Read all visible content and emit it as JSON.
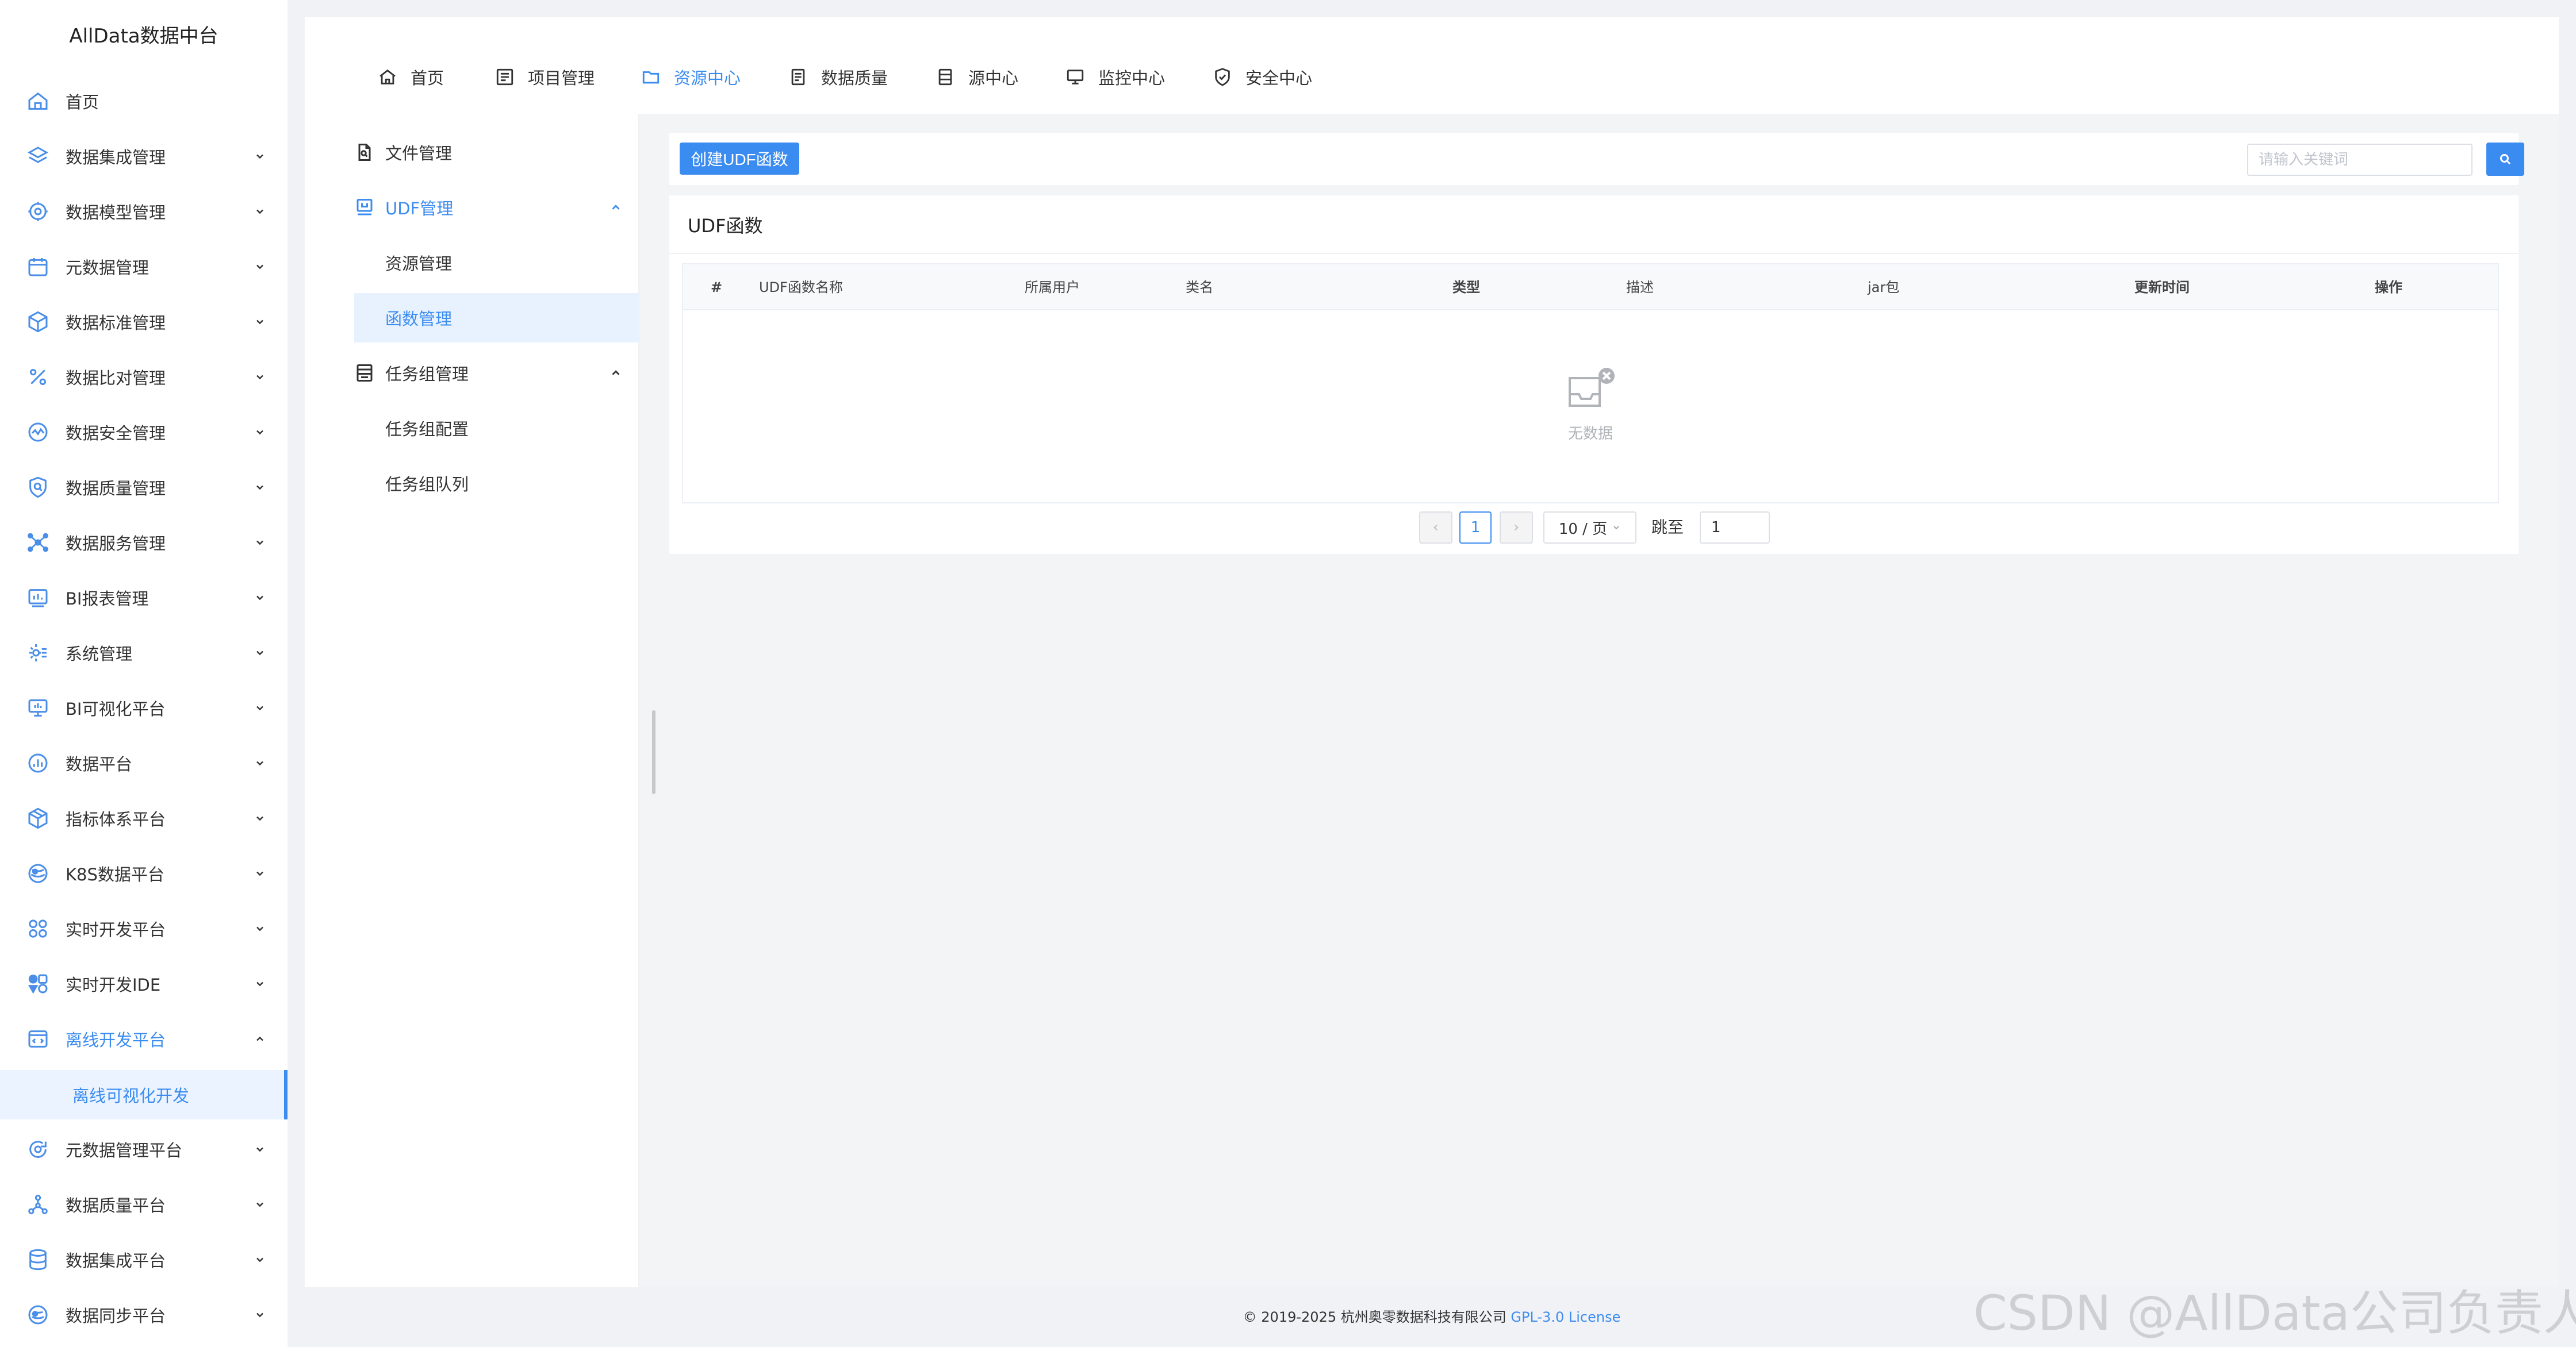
{
  "app": {
    "title": "AllData数据中台"
  },
  "sidebar": {
    "items": [
      {
        "label": "首页",
        "icon": "home-icon",
        "has_arrow": false
      },
      {
        "label": "数据集成管理",
        "icon": "layers-icon",
        "has_arrow": true
      },
      {
        "label": "数据模型管理",
        "icon": "cog-icon",
        "has_arrow": true
      },
      {
        "label": "元数据管理",
        "icon": "calendar-icon",
        "has_arrow": true
      },
      {
        "label": "数据标准管理",
        "icon": "cube-icon",
        "has_arrow": true
      },
      {
        "label": "数据比对管理",
        "icon": "percent-icon",
        "has_arrow": true
      },
      {
        "label": "数据安全管理",
        "icon": "shield-pulse-icon",
        "has_arrow": true
      },
      {
        "label": "数据质量管理",
        "icon": "search-shield-icon",
        "has_arrow": true
      },
      {
        "label": "数据服务管理",
        "icon": "network-icon",
        "has_arrow": true
      },
      {
        "label": "BI报表管理",
        "icon": "report-icon",
        "has_arrow": true
      },
      {
        "label": "系统管理",
        "icon": "gear-icon",
        "has_arrow": true
      },
      {
        "label": "BI可视化平台",
        "icon": "monitor-icon",
        "has_arrow": true
      },
      {
        "label": "数据平台",
        "icon": "chart-circle-icon",
        "has_arrow": true
      },
      {
        "label": "指标体系平台",
        "icon": "box-icon",
        "has_arrow": true
      },
      {
        "label": "K8S数据平台",
        "icon": "globe-icon",
        "has_arrow": true
      },
      {
        "label": "实时开发平台",
        "icon": "apps-icon",
        "has_arrow": true
      },
      {
        "label": "实时开发IDE",
        "icon": "ide-icon",
        "has_arrow": true
      },
      {
        "label": "离线开发平台",
        "icon": "code-window-icon",
        "has_arrow": true,
        "open": true
      },
      {
        "label": "元数据管理平台",
        "icon": "refresh-circle-icon",
        "has_arrow": true
      },
      {
        "label": "数据质量平台",
        "icon": "molecule-icon",
        "has_arrow": true
      },
      {
        "label": "数据集成平台",
        "icon": "database-icon",
        "has_arrow": true
      },
      {
        "label": "数据同步平台",
        "icon": "sync-globe-icon",
        "has_arrow": true
      }
    ],
    "open_sub": {
      "label": "离线可视化开发"
    }
  },
  "topnav": {
    "items": [
      {
        "label": "首页",
        "icon": "home-icon"
      },
      {
        "label": "项目管理",
        "icon": "project-icon"
      },
      {
        "label": "资源中心",
        "icon": "folder-icon",
        "active": true
      },
      {
        "label": "数据质量",
        "icon": "document-icon"
      },
      {
        "label": "源中心",
        "icon": "server-icon"
      },
      {
        "label": "监控中心",
        "icon": "monitor-icon"
      },
      {
        "label": "安全中心",
        "icon": "shield-check-icon"
      }
    ]
  },
  "subnav": {
    "file_manage": "文件管理",
    "udf_manage": "UDF管理",
    "resource_manage": "资源管理",
    "function_manage": "函数管理",
    "task_group_manage": "任务组管理",
    "task_group_config": "任务组配置",
    "task_group_queue": "任务组队列"
  },
  "toolbar": {
    "create_label": "创建UDF函数",
    "search_placeholder": "请输入关键词",
    "search_value": ""
  },
  "panel": {
    "title": "UDF函数",
    "columns": [
      "#",
      "UDF函数名称",
      "所属用户",
      "类名",
      "类型",
      "描述",
      "jar包",
      "更新时间",
      "操作"
    ],
    "rows": [],
    "empty_text": "无数据"
  },
  "pagination": {
    "current_page": "1",
    "page_size": "10 / 页",
    "jump_label": "跳至",
    "jump_value": "1"
  },
  "footer": {
    "copyright": "© 2019-2025 杭州奥零数据科技有限公司",
    "license": "GPL-3.0 License"
  },
  "watermark": "CSDN @AllData公司负责人",
  "colors": {
    "accent": "#3b8cf0",
    "background": "#f0f2f5",
    "active_bg": "#eaf3ff"
  }
}
